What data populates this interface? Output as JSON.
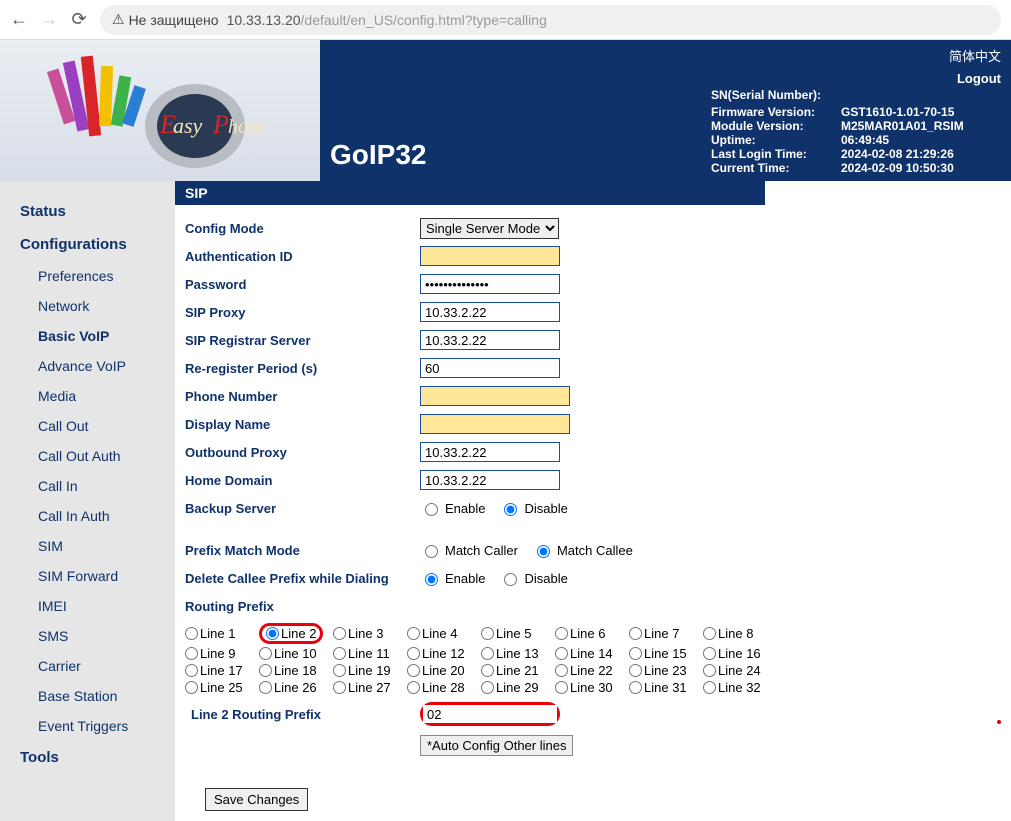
{
  "browser": {
    "security_text": "Не защищено",
    "url_host": "10.33.13.20",
    "url_path": "/default/en_US/config.html?type=calling"
  },
  "header": {
    "product_name": "GoIP32",
    "lang_link": "简体中文",
    "logout": "Logout",
    "info": {
      "sn_label": "SN(Serial Number):",
      "sn_value": "",
      "fw_label": "Firmware Version:",
      "fw_value": "GST1610-1.01-70-15",
      "mod_label": "Module Version:",
      "mod_value": "M25MAR01A01_RSIM",
      "uptime_label": "Uptime:",
      "uptime_value": "06:49:45",
      "lastlogin_label": "Last Login Time:",
      "lastlogin_value": "2024-02-08 21:29:26",
      "curtime_label": "Current Time:",
      "curtime_value": "2024-02-09 10:50:30"
    }
  },
  "sidebar": {
    "status": "Status",
    "configurations": "Configurations",
    "items": [
      "Preferences",
      "Network",
      "Basic VoIP",
      "Advance VoIP",
      "Media",
      "Call Out",
      "Call Out Auth",
      "Call In",
      "Call In Auth",
      "SIM",
      "SIM Forward",
      "IMEI",
      "SMS",
      "Carrier",
      "Base Station",
      "Event Triggers"
    ],
    "tools": "Tools"
  },
  "form": {
    "section_title": "SIP",
    "config_mode_label": "Config Mode",
    "config_mode_value": "Single Server Mode",
    "auth_id_label": "Authentication ID",
    "auth_id_value": "",
    "password_label": "Password",
    "password_value": "••••••••••••••",
    "sip_proxy_label": "SIP Proxy",
    "sip_proxy_value": "10.33.2.22",
    "sip_reg_label": "SIP Registrar Server",
    "sip_reg_value": "10.33.2.22",
    "rereg_label": "Re-register Period (s)",
    "rereg_value": "60",
    "phone_label": "Phone Number",
    "phone_value": "",
    "display_label": "Display Name",
    "display_value": "",
    "outbound_label": "Outbound Proxy",
    "outbound_value": "10.33.2.22",
    "home_label": "Home Domain",
    "home_value": "10.33.2.22",
    "backup_label": "Backup Server",
    "enable": "Enable",
    "disable": "Disable",
    "prefix_match_label": "Prefix Match Mode",
    "match_caller": "Match Caller",
    "match_callee": "Match Callee",
    "delete_callee_label": "Delete Callee Prefix while Dialing",
    "routing_prefix_label": "Routing Prefix",
    "lines": [
      "Line 1",
      "Line 2",
      "Line 3",
      "Line 4",
      "Line 5",
      "Line 6",
      "Line 7",
      "Line 8",
      "Line 9",
      "Line 10",
      "Line 11",
      "Line 12",
      "Line 13",
      "Line 14",
      "Line 15",
      "Line 16",
      "Line 17",
      "Line 18",
      "Line 19",
      "Line 20",
      "Line 21",
      "Line 22",
      "Line 23",
      "Line 24",
      "Line 25",
      "Line 26",
      "Line 27",
      "Line 28",
      "Line 29",
      "Line 30",
      "Line 31",
      "Line 32"
    ],
    "selected_line": "Line 2",
    "line_routing_label": "Line 2 Routing Prefix",
    "line_routing_value": "02",
    "auto_config_btn": "*Auto Config Other lines",
    "save_btn": "Save Changes"
  }
}
